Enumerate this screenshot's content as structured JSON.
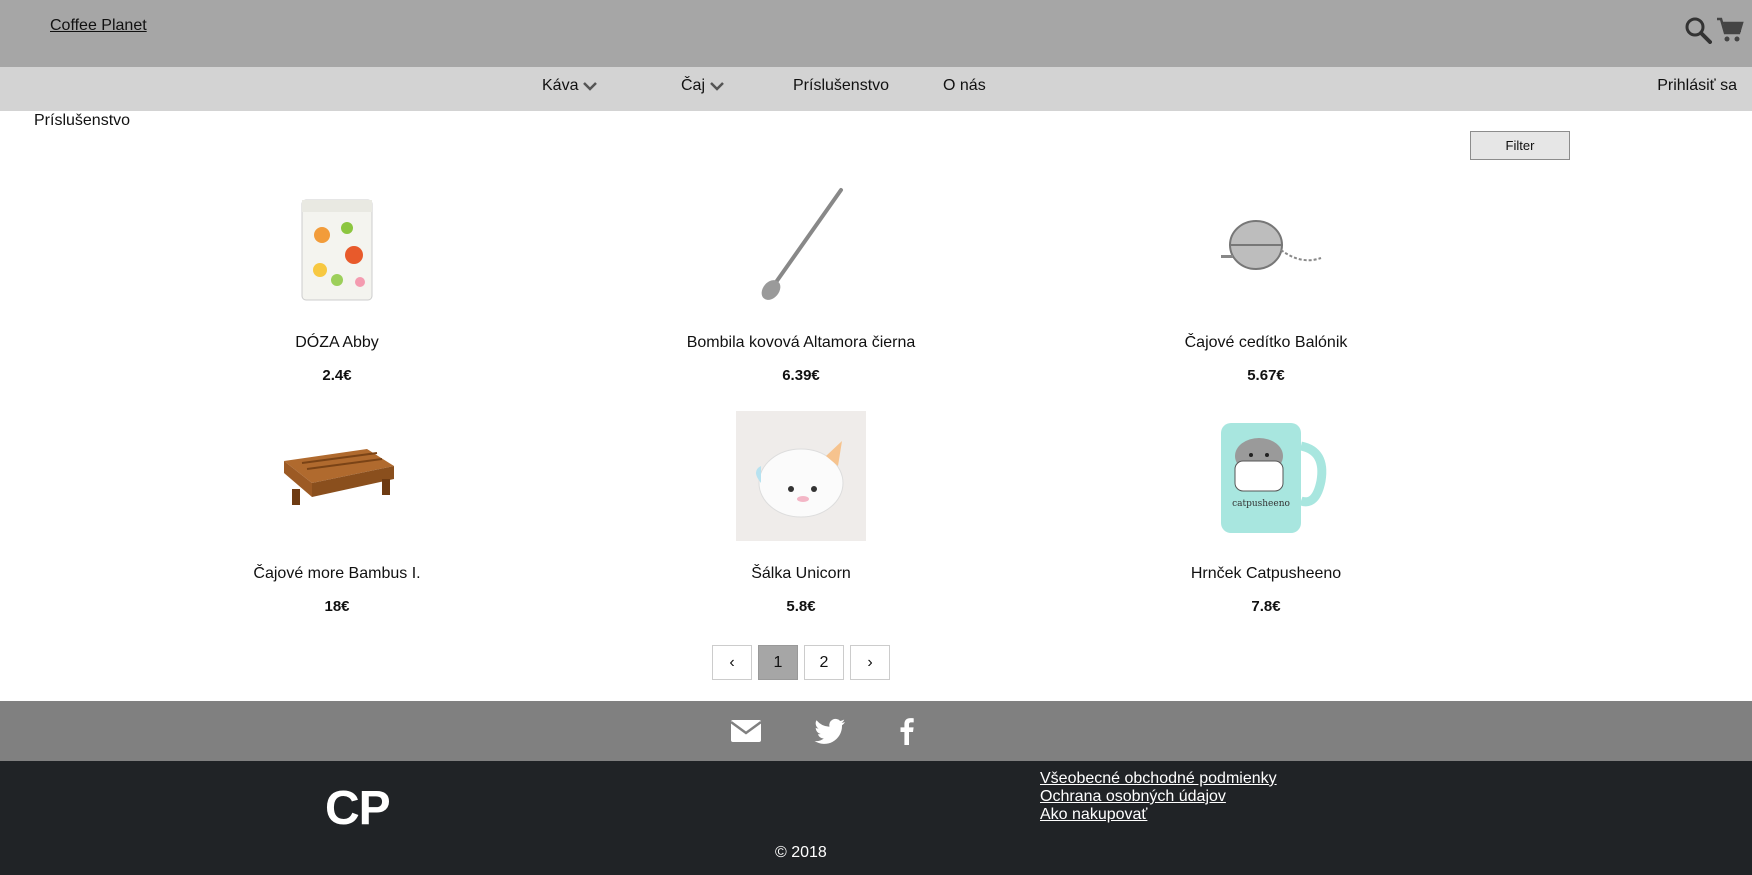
{
  "header": {
    "brand": "Coffee Planet",
    "icons": [
      "search-icon",
      "cart-icon"
    ]
  },
  "nav": {
    "items": [
      {
        "label": "Káva",
        "has_dropdown": true
      },
      {
        "label": "Čaj",
        "has_dropdown": true
      },
      {
        "label": "Príslušenstvo",
        "has_dropdown": false
      },
      {
        "label": "O nás",
        "has_dropdown": false
      }
    ],
    "login": "Prihlásiť sa"
  },
  "page": {
    "breadcrumb": "Príslušenstvo",
    "filter_label": "Filter"
  },
  "products": [
    {
      "name": "DÓZA Abby",
      "price": "2.4€"
    },
    {
      "name": "Bombila kovová Altamora čierna",
      "price": "6.39€"
    },
    {
      "name": "Čajové cedítko Balónik",
      "price": "5.67€"
    },
    {
      "name": "Čajové more Bambus I.",
      "price": "18€"
    },
    {
      "name": "Šálka Unicorn",
      "price": "5.8€"
    },
    {
      "name": "Hrnček Catpusheeno",
      "price": "7.8€"
    }
  ],
  "pagination": {
    "prev": "‹",
    "pages": [
      "1",
      "2"
    ],
    "current": "1",
    "next": "›"
  },
  "social": [
    "mail-icon",
    "twitter-icon",
    "facebook-icon"
  ],
  "footer": {
    "logo": "CP",
    "links": [
      "Všeobecné obchodné podmienky",
      "Ochrana osobných údajov",
      "Ako nakupovať"
    ],
    "copyright": "© 2018"
  },
  "colors": {
    "topbar": "#a6a6a6",
    "navbar": "#d3d3d3",
    "social_bar": "#808080",
    "footer": "#202326",
    "active_page": "#a6a6a6"
  }
}
